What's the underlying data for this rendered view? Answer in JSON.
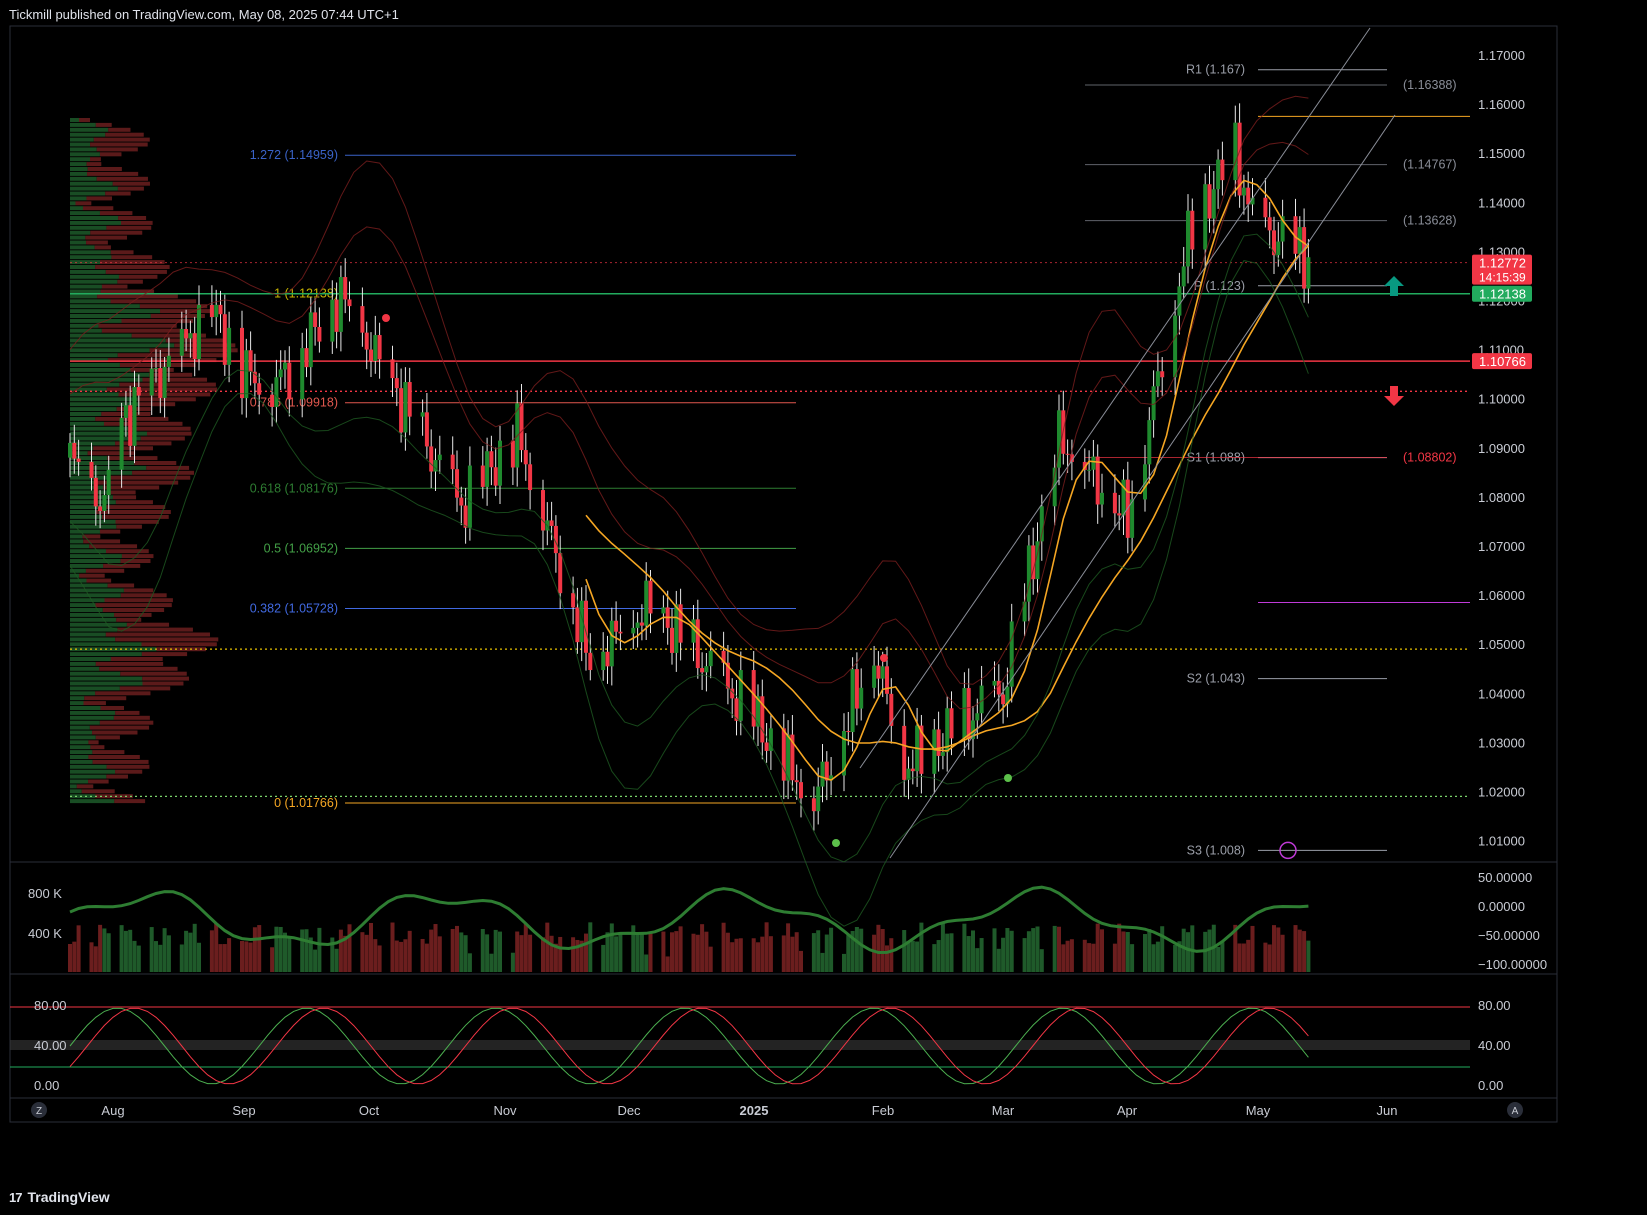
{
  "header": {
    "published": "Tickmill published on TradingView.com, May 08, 2025 07:44 UTC+1"
  },
  "footer": {
    "brand": "TradingView",
    "logo_glyph": "17"
  },
  "corner": {
    "left_btn": "Z",
    "right_btn": "A"
  },
  "colors": {
    "up": "#089981",
    "up_candle": "#1f8a2e",
    "down": "#f23645",
    "gold": "#f5a623",
    "grid": "#1a1a1a",
    "panel_border": "#2a2e39"
  },
  "price_axis": [
    "1.17000",
    "1.16000",
    "1.15000",
    "1.14000",
    "1.13000",
    "1.12000",
    "1.11000",
    "1.10000",
    "1.09000",
    "1.08000",
    "1.07000",
    "1.06000",
    "1.05000",
    "1.04000",
    "1.03000",
    "1.02000",
    "1.01000"
  ],
  "price_badges": [
    {
      "text": "1.12772",
      "sub": "14:15:39",
      "color": "#f23645"
    },
    {
      "text": "1.12138",
      "color": "#22ab5e"
    },
    {
      "text": "1.10766",
      "color": "#f23645"
    }
  ],
  "fib_levels": [
    {
      "label": "1.272 (1.14959)",
      "price": 1.14959,
      "color": "#3a63c8"
    },
    {
      "label": "1 (1.12138)",
      "price": 1.12138,
      "color": "#c8b400"
    },
    {
      "label": "0.786 (1.09918)",
      "price": 1.09918,
      "color": "#e0574e"
    },
    {
      "label": "0.618 (1.08176)",
      "price": 1.08176,
      "color": "#2e7d32"
    },
    {
      "label": "0.5 (1.06952)",
      "price": 1.06952,
      "color": "#43a047"
    },
    {
      "label": "0.382 (1.05728)",
      "price": 1.05728,
      "color": "#4169e1"
    },
    {
      "label": "0 (1.01766)",
      "price": 1.01766,
      "color": "#f5a623"
    }
  ],
  "pivots": [
    {
      "label": "R1 (1.167)",
      "price": 1.167
    },
    {
      "label": "P (1.123)",
      "price": 1.123
    },
    {
      "label": "S1 (1.088)",
      "price": 1.088
    },
    {
      "label": "S2 (1.043)",
      "price": 1.043
    },
    {
      "label": "S3 (1.008)",
      "price": 1.008
    }
  ],
  "right_labels": [
    {
      "label": "(1.16388)",
      "price": 1.16388,
      "color": "#8a8e98"
    },
    {
      "label": "(1.14767)",
      "price": 1.14767,
      "color": "#8a8e98"
    },
    {
      "label": "(1.13628)",
      "price": 1.13628,
      "color": "#8a8e98"
    },
    {
      "label": "(1.08802)",
      "price": 1.08802,
      "color": "#f23645"
    }
  ],
  "vol_axis_left": [
    "800 K",
    "400 K"
  ],
  "osc_axis_right": [
    "50.00000",
    "0.00000",
    "−50.00000",
    "−100.00000"
  ],
  "stoch_axis": [
    "80.00",
    "40.00",
    "0.00"
  ],
  "x_axis": [
    {
      "label": "Aug",
      "bold": false
    },
    {
      "label": "Sep",
      "bold": false
    },
    {
      "label": "Oct",
      "bold": false
    },
    {
      "label": "Nov",
      "bold": false
    },
    {
      "label": "Dec",
      "bold": false
    },
    {
      "label": "2025",
      "bold": true
    },
    {
      "label": "Feb",
      "bold": false
    },
    {
      "label": "Mar",
      "bold": false
    },
    {
      "label": "Apr",
      "bold": false
    },
    {
      "label": "May",
      "bold": false
    },
    {
      "label": "Jun",
      "bold": false
    }
  ],
  "chart_data": {
    "type": "candlestick",
    "symbol_range": {
      "ylim": [
        1.0,
        1.175
      ]
    },
    "last_price": 1.12772,
    "series_keypoints": [
      {
        "t": "2024-07-24",
        "price": 1.088
      },
      {
        "t": "2024-08-01",
        "price": 1.078
      },
      {
        "t": "2024-08-05",
        "price": 1.095
      },
      {
        "t": "2024-08-26",
        "price": 1.118
      },
      {
        "t": "2024-09-03",
        "price": 1.105
      },
      {
        "t": "2024-09-10",
        "price": 1.103
      },
      {
        "t": "2024-09-25",
        "price": 1.121
      },
      {
        "t": "2024-10-23",
        "price": 1.078
      },
      {
        "t": "2024-11-05",
        "price": 1.093
      },
      {
        "t": "2024-11-22",
        "price": 1.047
      },
      {
        "t": "2024-12-06",
        "price": 1.058
      },
      {
        "t": "2024-12-30",
        "price": 1.035
      },
      {
        "t": "2025-01-13",
        "price": 1.018
      },
      {
        "t": "2025-01-27",
        "price": 1.049
      },
      {
        "t": "2025-02-03",
        "price": 1.025
      },
      {
        "t": "2025-02-26",
        "price": 1.04
      },
      {
        "t": "2025-03-11",
        "price": 1.092
      },
      {
        "t": "2025-03-27",
        "price": 1.076
      },
      {
        "t": "2025-04-11",
        "price": 1.136
      },
      {
        "t": "2025-04-21",
        "price": 1.15
      },
      {
        "t": "2025-04-25",
        "price": 1.136
      },
      {
        "t": "2025-05-08",
        "price": 1.128
      }
    ],
    "moving_averages": [
      {
        "period_color": "#f5a623",
        "start": 1.05,
        "end": 1.119
      },
      {
        "period_color": "#f5a623",
        "start": 1.038,
        "end": 1.085
      }
    ]
  }
}
